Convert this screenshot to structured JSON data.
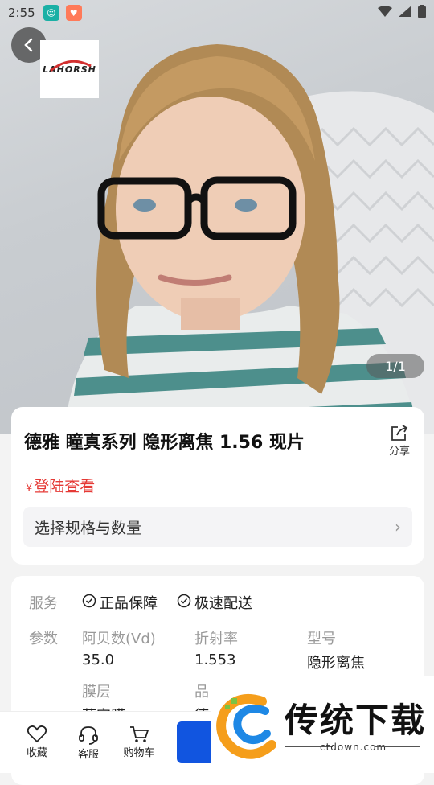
{
  "status_bar": {
    "time": "2:55"
  },
  "hero": {
    "brand_text": "LAHORSH",
    "image_counter": "1/1"
  },
  "product": {
    "title": "德雅 瞳真系列 隐形离焦 1.56 现片",
    "share_label": "分享",
    "price_symbol": "¥",
    "price_text": "登陆查看",
    "spec_label": "选择规格与数量"
  },
  "details": {
    "service_label": "服务",
    "services": [
      "正品保障",
      "极速配送"
    ],
    "params_label": "参数",
    "params": [
      {
        "key": "阿贝数(Vd)",
        "value": "35.0"
      },
      {
        "key": "折射率",
        "value": "1.553"
      },
      {
        "key": "型号",
        "value": "隐形离焦"
      },
      {
        "key": "膜层",
        "value": "蓝定膜"
      },
      {
        "key": "品",
        "value": "德"
      }
    ]
  },
  "bottom_bar": {
    "tabs": [
      "收藏",
      "客服",
      "购物车"
    ]
  },
  "watermark": {
    "title": "传统下载",
    "url": "ctdown.com"
  },
  "colors": {
    "price": "#e53935",
    "buy_button": "#1155e0"
  }
}
